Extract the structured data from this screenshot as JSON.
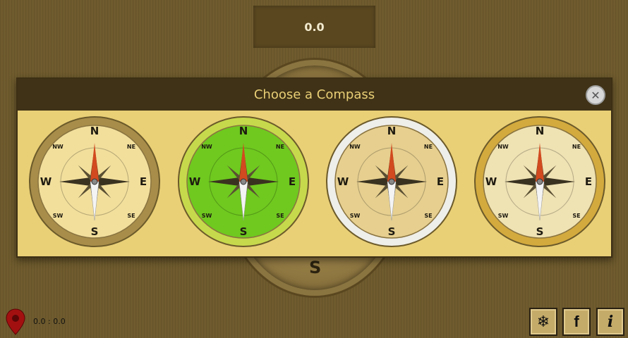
{
  "heading_value": "0.0",
  "dialog": {
    "title": "Choose a Compass",
    "close_icon": "close-icon"
  },
  "background_compass": {
    "south_label": "S"
  },
  "compass_options": [
    {
      "name": "gold-world-compass",
      "labels": {
        "n": "N",
        "s": "S",
        "e": "E",
        "w": "W",
        "ne": "NE",
        "nw": "NW",
        "se": "SE",
        "sw": "SW"
      },
      "colors": {
        "bezel": "#a88d4a",
        "face": "#f2df9c",
        "needle_north": "#d24a1f"
      }
    },
    {
      "name": "green-glass-compass",
      "labels": {
        "n": "N",
        "s": "S",
        "e": "E",
        "w": "W",
        "ne": "NE",
        "nw": "NW",
        "se": "SE",
        "sw": "SW"
      },
      "colors": {
        "bezel": "#c6d94c",
        "face": "#6fc91f",
        "needle_north": "#d24a1f"
      }
    },
    {
      "name": "silver-classic-compass",
      "labels": {
        "n": "N",
        "s": "S",
        "e": "E",
        "w": "W",
        "ne": "NE",
        "nw": "NW",
        "se": "SE",
        "sw": "SW"
      },
      "colors": {
        "bezel": "#eeeeea",
        "face": "#e6cf8f",
        "needle_north": "#d24a1f"
      }
    },
    {
      "name": "golden-ornate-compass",
      "labels": {
        "n": "N",
        "s": "S",
        "e": "E",
        "w": "W",
        "ne": "NE",
        "nw": "NW",
        "se": "SE",
        "sw": "SW"
      },
      "colors": {
        "bezel": "#d3aa3d",
        "face": "#efe2b3",
        "needle_north": "#d24a1f"
      }
    }
  ],
  "location": {
    "coordinates": "0.0 : 0.0",
    "icon": "location-pin-icon"
  },
  "footer_buttons": [
    {
      "name": "snowflake-button",
      "icon": "snowflake-icon",
      "glyph": "❄"
    },
    {
      "name": "facebook-button",
      "icon": "facebook-icon",
      "glyph": "f"
    },
    {
      "name": "info-button",
      "icon": "info-icon",
      "glyph": "i"
    }
  ]
}
